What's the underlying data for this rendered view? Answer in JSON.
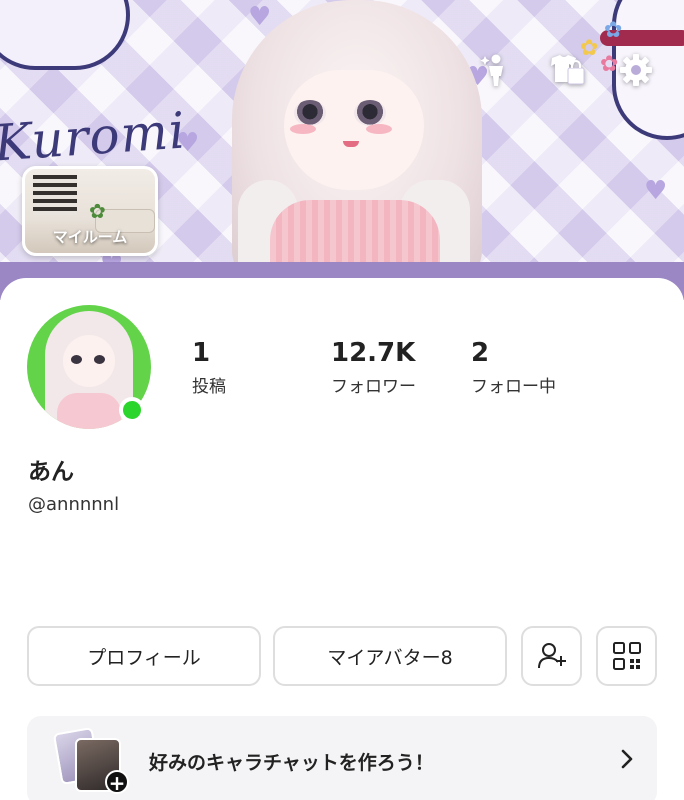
{
  "cover": {
    "brand_text": "Kuromi",
    "myroom_label": "マイルーム",
    "action_icons": [
      "avatar-pose-icon",
      "closet-icon",
      "settings-gear-icon"
    ]
  },
  "profile": {
    "stats": [
      {
        "value": "1",
        "label": "投稿"
      },
      {
        "value": "12.7K",
        "label": "フォロワー"
      },
      {
        "value": "2",
        "label": "フォロー中"
      }
    ],
    "display_name": "あん",
    "handle": "@annnnnl",
    "online": true
  },
  "actions": {
    "profile_button": "プロフィール",
    "my_avatar_button": "マイアバター8",
    "add_friend_icon": "add-friend-icon",
    "qr_icon": "qr-code-icon"
  },
  "promo": {
    "text": "好みのキャラチャットを作ろう！",
    "plus": "+"
  },
  "colors": {
    "online": "#2bd52b",
    "avatar_bg": "#63d34a",
    "cover_band": "#9a87c4",
    "border": "#dedede"
  }
}
